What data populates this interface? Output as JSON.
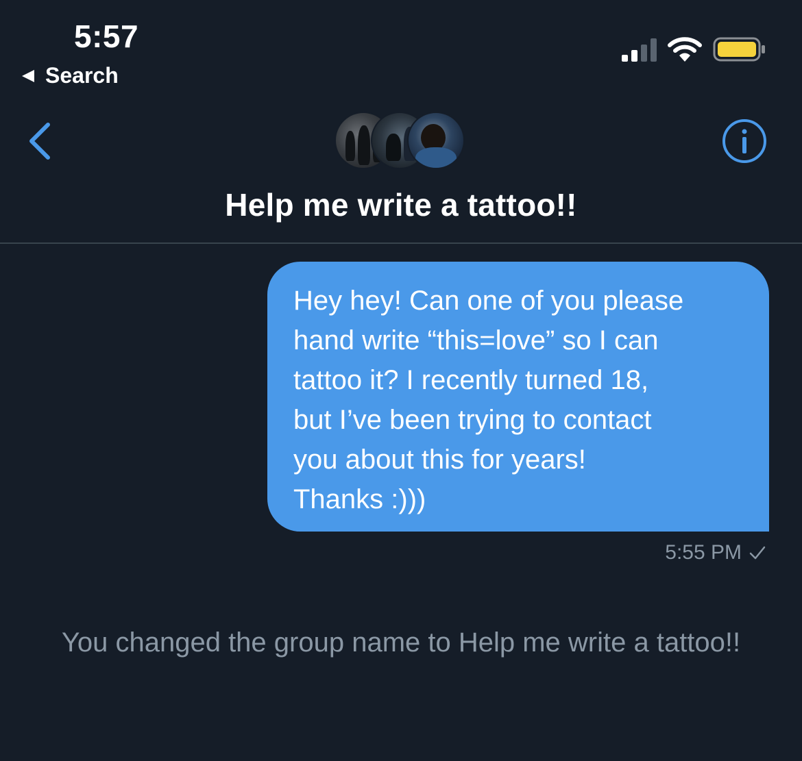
{
  "status_bar": {
    "time": "5:57",
    "back_app": "Search",
    "battery_color": "#f5d23c"
  },
  "conversation": {
    "title": "Help me write a tattoo!!",
    "avatars": [
      "avatar-1",
      "avatar-2",
      "avatar-3"
    ],
    "icons": {
      "back": "chevron-left-icon",
      "info": "info-icon"
    },
    "accent_color": "#4a99e9"
  },
  "messages": [
    {
      "text": "Hey hey! Can one of you please\nhand write “this=love” so I can\ntattoo it? I recently turned 18,\nbut I’ve been trying to contact\nyou about this for years!\nThanks :)))",
      "time": "5:55 PM",
      "status_icon": "checkmark-icon"
    }
  ],
  "system_note": "You changed the group name to Help me write a tattoo!!"
}
